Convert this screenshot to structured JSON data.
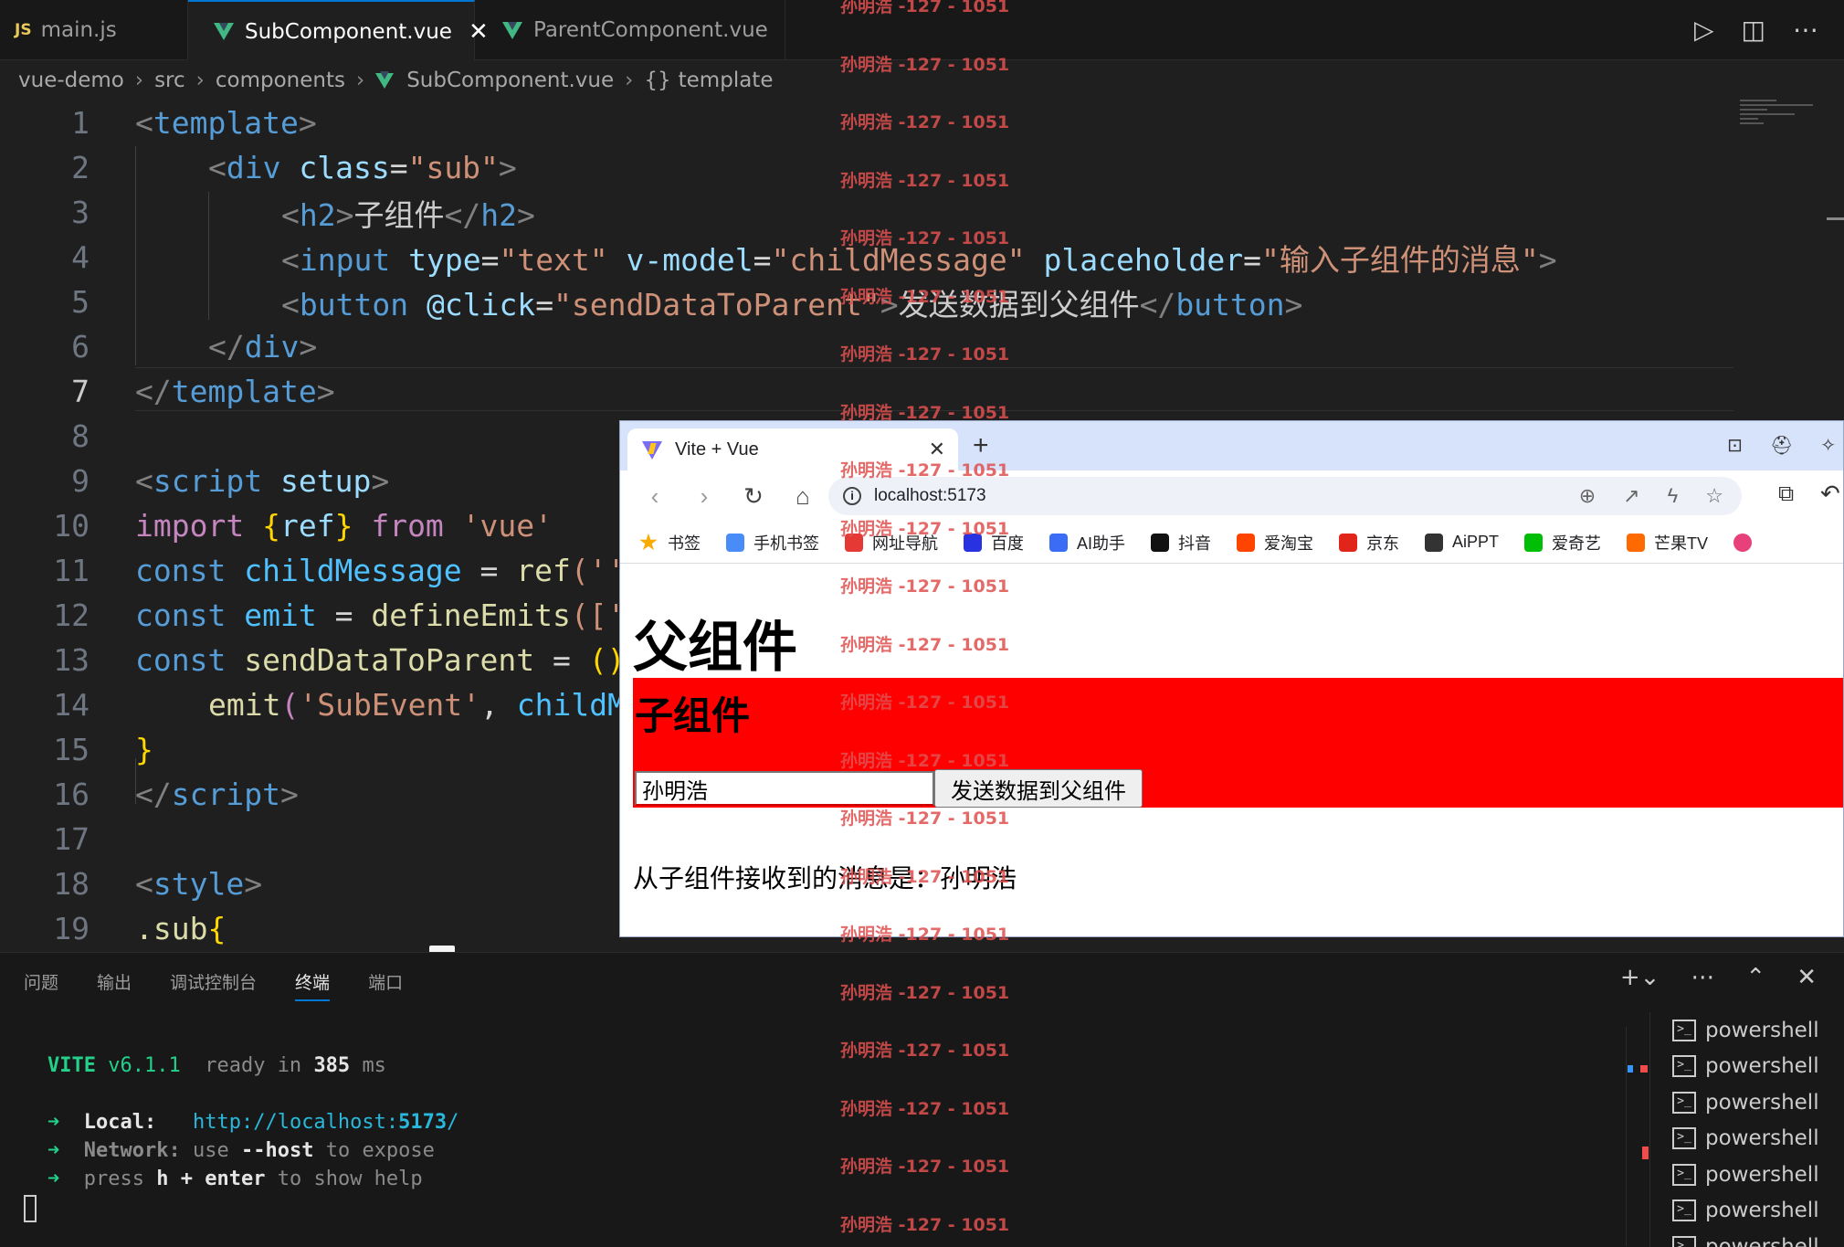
{
  "editor_tabs": [
    {
      "icon": "JS",
      "label": "main.js"
    },
    {
      "label": "SubComponent.vue",
      "close": "✕"
    },
    {
      "label": "ParentComponent.vue"
    }
  ],
  "breadcrumb": {
    "items": [
      "vue-demo",
      "src",
      "components",
      "SubComponent.vue",
      "template"
    ],
    "symbol_icon": "{}"
  },
  "code": {
    "line_numbers": [
      "1",
      "2",
      "3",
      "4",
      "5",
      "6",
      "7",
      "8",
      "9",
      "10",
      "11",
      "12",
      "13",
      "14",
      "15",
      "16",
      "17",
      "18",
      "19"
    ],
    "active_line": "7",
    "l1": {
      "open": "<",
      "tag": "template",
      "close": ">"
    },
    "l2": {
      "open": "<",
      "tag": "div",
      "attr": "class",
      "eq": "=",
      "val": "\"sub\"",
      "close": ">"
    },
    "l3": {
      "open": "<",
      "tag": "h2",
      "close": ">",
      "text": "子组件",
      "end_open": "</",
      "end_tag": "h2",
      "end_close": ">"
    },
    "l4": {
      "open": "<",
      "tag": "input",
      "a1": "type",
      "v1": "\"text\"",
      "a2": "v-model",
      "v2": "\"childMessage\"",
      "a3": "placeholder",
      "v3": "\"输入子组件的消息\"",
      "close": ">"
    },
    "l5": {
      "open": "<",
      "tag": "button",
      "a1": "@click",
      "v1": "\"sendDataToParent\"",
      "close": ">",
      "text": "发送数据到父组件",
      "end_open": "</",
      "end_tag": "button",
      "end_close": ">"
    },
    "l6": {
      "open": "</",
      "tag": "div",
      "close": ">"
    },
    "l7": {
      "open": "</",
      "tag": "template",
      "close": ">"
    },
    "l9": {
      "open": "<",
      "tag": "script",
      "attr": "setup",
      "close": ">"
    },
    "l10": {
      "kw": "import",
      "b1": "{",
      "name": "ref",
      "b2": "}",
      "from": "from",
      "str": "'vue'"
    },
    "l11": {
      "kw": "const",
      "name": "childMessage",
      "op": "=",
      "fn": "ref",
      "rest": "(''"
    },
    "l12": {
      "kw": "const",
      "name": "emit",
      "op": "=",
      "fn": "defineEmits",
      "rest": "(['"
    },
    "l13": {
      "kw": "const",
      "name": "sendDataToParent",
      "op": "=",
      "rest": "()"
    },
    "l14": {
      "fn": "emit",
      "p": "(",
      "str": "'SubEvent'",
      "comma": ",",
      "name": "childM"
    },
    "l15": {
      "br": "}"
    },
    "l16": {
      "open": "</",
      "tag": "script",
      "close": ">"
    },
    "l18": {
      "open": "<",
      "tag": "style",
      "close": ">"
    },
    "l19": {
      "sel": ".sub",
      "br": "{"
    }
  },
  "watermark": "孙明浩 -127 - 1051",
  "browser": {
    "tab_title": "Vite + Vue",
    "tab_close": "✕",
    "new_tab": "+",
    "url": "localhost:5173",
    "bookmarks": [
      {
        "label": "书签",
        "color": "#f9ab00"
      },
      {
        "label": "手机书签",
        "color": "#4a8cf7"
      },
      {
        "label": "网址导航",
        "color": "#e53935"
      },
      {
        "label": "百度",
        "color": "#2932e1"
      },
      {
        "label": "AI助手",
        "color": "#3b6cf6"
      },
      {
        "label": "抖音",
        "color": "#111111"
      },
      {
        "label": "爱淘宝",
        "color": "#ff4400"
      },
      {
        "label": "京东",
        "color": "#e1251b"
      },
      {
        "label": "AiPPT",
        "color": "#333333"
      },
      {
        "label": "爱奇艺",
        "color": "#00be06"
      },
      {
        "label": "芒果TV",
        "color": "#ff6a00"
      }
    ],
    "page": {
      "parent_heading": "父组件",
      "child_heading": "子组件",
      "input_value": "孙明浩",
      "button_label": "发送数据到父组件",
      "received_text": "从子组件接收到的消息是：孙明浩"
    }
  },
  "panel": {
    "tabs": [
      "问题",
      "输出",
      "调试控制台",
      "终端",
      "端口"
    ],
    "active_tab": "终端",
    "terminal": {
      "vite": "VITE",
      "version": "v6.1.1",
      "ready": "ready in",
      "ms_value": "385",
      "ms": "ms",
      "arrow": "➜",
      "local_label": "Local:",
      "local_url_a": "http://localhost:",
      "local_port": "5173",
      "local_url_b": "/",
      "network_label": "Network:",
      "use": "use",
      "host": "--host",
      "to_expose": "to expose",
      "press": "press",
      "h": "h",
      "plus": "+",
      "enter": "enter",
      "to_show_help": "to show help"
    },
    "terminal_list": [
      "powershell",
      "powershell",
      "powershell",
      "powershell",
      "powershell",
      "powershell",
      "powershell"
    ]
  },
  "colors": {
    "accent": "#0078d4",
    "vue_green": "#41b883",
    "sub_bg": "#ff0000"
  }
}
